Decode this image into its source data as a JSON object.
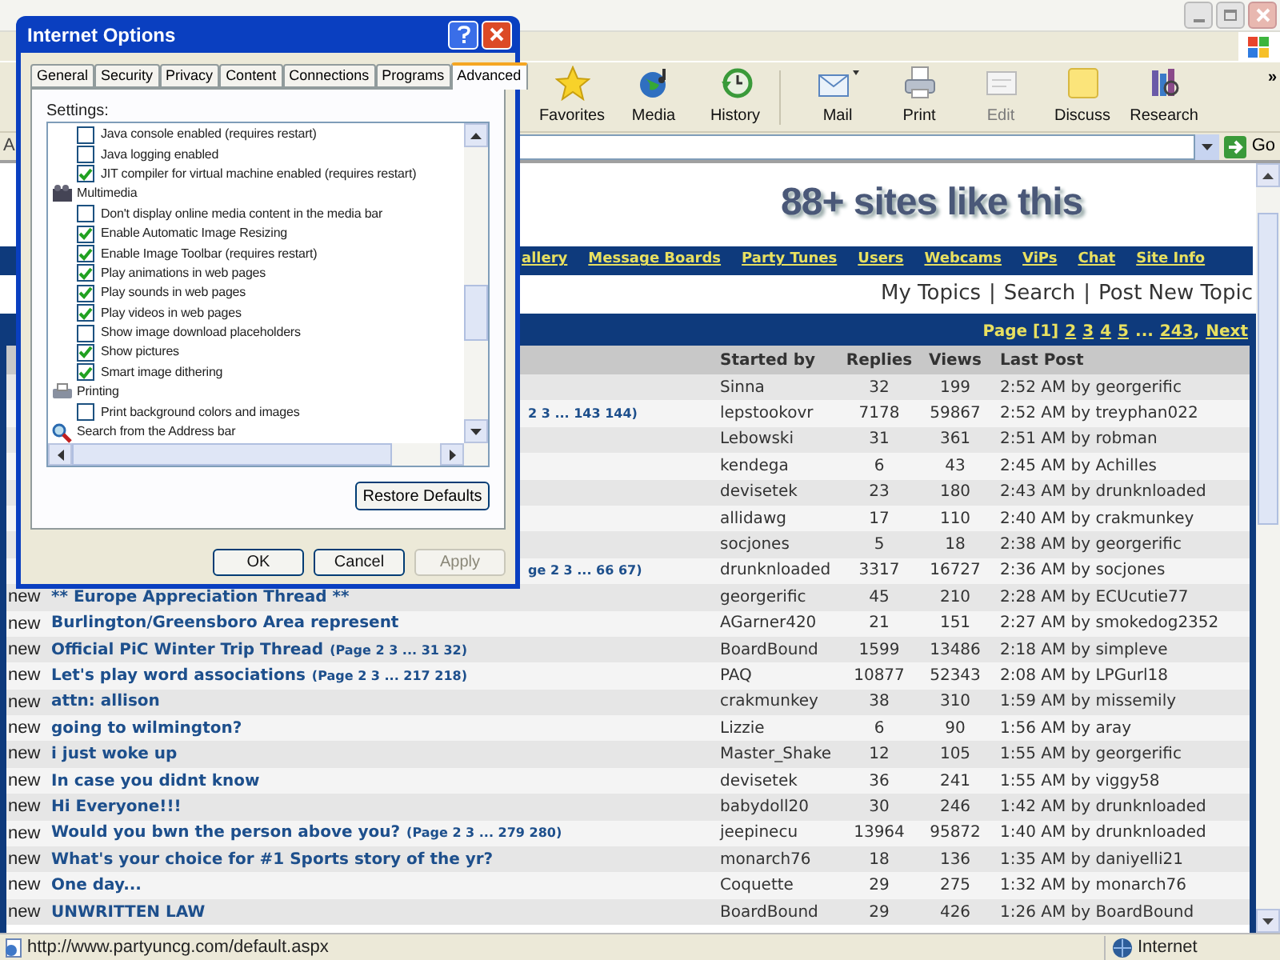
{
  "address_bar": {
    "label": "A",
    "go": "Go"
  },
  "toolbar_overflow": "»",
  "toolbar": [
    {
      "label": "Favorites",
      "disabled": false
    },
    {
      "label": "Media",
      "disabled": false
    },
    {
      "label": "History",
      "disabled": false
    },
    {
      "label": "Mail",
      "disabled": false
    },
    {
      "label": "Print",
      "disabled": false
    },
    {
      "label": "Edit",
      "disabled": true
    },
    {
      "label": "Discuss",
      "disabled": false
    },
    {
      "label": "Research",
      "disabled": false
    }
  ],
  "page": {
    "banner": "88+ sites like this",
    "nav_links": [
      "allery",
      "Message Boards",
      "Party Tunes",
      "Users",
      "Webcams",
      "ViPs",
      "Chat",
      "Site Info"
    ],
    "topic_links": {
      "items": [
        "My Topics",
        "Search",
        "Post New Topic"
      ],
      "separator": "|"
    },
    "pagination": [
      {
        "text": "Page [1]",
        "link": false
      },
      {
        "text": "2",
        "link": true
      },
      {
        "text": "3",
        "link": true
      },
      {
        "text": "4",
        "link": true
      },
      {
        "text": "5",
        "link": true
      },
      {
        "text": "...",
        "link": false
      },
      {
        "text": "243",
        "link": true,
        "suffix": ","
      },
      {
        "text": "Next",
        "link": true
      }
    ],
    "table": {
      "columns": [
        "Started by",
        "Replies",
        "Views",
        "Last Post"
      ],
      "rows": [
        {
          "started_by": "Sinna",
          "replies": "32",
          "views": "199",
          "last_post": "2:52 AM by georgerific"
        },
        {
          "pages": "2 3 ... 143 144)",
          "started_by": "lepstookovr",
          "replies": "7178",
          "views": "59867",
          "last_post": "2:52 AM by treyphan022"
        },
        {
          "started_by": "Lebowski",
          "replies": "31",
          "views": "361",
          "last_post": "2:51 AM by robman"
        },
        {
          "started_by": "kendega",
          "replies": "6",
          "views": "43",
          "last_post": "2:45 AM by Achilles"
        },
        {
          "started_by": "devisetek",
          "replies": "23",
          "views": "180",
          "last_post": "2:43 AM by drunknloaded"
        },
        {
          "started_by": "allidawg",
          "replies": "17",
          "views": "110",
          "last_post": "2:40 AM by crakmunkey"
        },
        {
          "started_by": "socjones",
          "replies": "5",
          "views": "18",
          "last_post": "2:38 AM by georgerific"
        },
        {
          "pages": "ge 2 3 ... 66 67)",
          "started_by": "drunknloaded",
          "replies": "3317",
          "views": "16727",
          "last_post": "2:36 AM by socjones"
        },
        {
          "status": "new",
          "title": "** Europe Appreciation Thread **",
          "started_by": "georgerific",
          "replies": "45",
          "views": "210",
          "last_post": "2:28 AM by ECUcutie77"
        },
        {
          "status": "new",
          "title": "Burlington/Greensboro Area represent",
          "started_by": "AGarner420",
          "replies": "21",
          "views": "151",
          "last_post": "2:27 AM by smokedog2352"
        },
        {
          "status": "new",
          "title": "Official PiC Winter Trip Thread",
          "pages": "(Page 2 3 ... 31 32)",
          "started_by": "BoardBound",
          "replies": "1599",
          "views": "13486",
          "last_post": "2:18 AM by simpleve"
        },
        {
          "status": "new",
          "title": "Let's play word associations",
          "pages": "(Page 2 3 ... 217 218)",
          "started_by": "PAQ",
          "replies": "10877",
          "views": "52343",
          "last_post": "2:08 AM by LPGurl18"
        },
        {
          "status": "new",
          "title": "attn: allison",
          "started_by": "crakmunkey",
          "replies": "38",
          "views": "310",
          "last_post": "1:59 AM by missemily"
        },
        {
          "status": "new",
          "title": "going to wilmington?",
          "started_by": "Lizzie",
          "replies": "6",
          "views": "90",
          "last_post": "1:56 AM by aray"
        },
        {
          "status": "new",
          "title": "i just woke up",
          "started_by": "Master_Shake",
          "replies": "12",
          "views": "105",
          "last_post": "1:55 AM by georgerific"
        },
        {
          "status": "new",
          "title": "In case you didnt know",
          "started_by": "devisetek",
          "replies": "36",
          "views": "241",
          "last_post": "1:55 AM by viggy58"
        },
        {
          "status": "new",
          "title": "Hi Everyone!!!",
          "started_by": "babydoll20",
          "replies": "30",
          "views": "246",
          "last_post": "1:42 AM by drunknloaded"
        },
        {
          "status": "new",
          "title": "Would you bwn the person above you?",
          "pages": "(Page 2 3 ... 279 280)",
          "started_by": "jeepinecu",
          "replies": "13964",
          "views": "95872",
          "last_post": "1:40 AM by drunknloaded"
        },
        {
          "status": "new",
          "title": "What's your choice for #1 Sports story of the yr?",
          "started_by": "monarch76",
          "replies": "18",
          "views": "136",
          "last_post": "1:35 AM by daniyelli21"
        },
        {
          "status": "new",
          "title": "One day...",
          "started_by": "Coquette",
          "replies": "29",
          "views": "275",
          "last_post": "1:32 AM by monarch76"
        },
        {
          "status": "new",
          "title": "UNWRITTEN LAW",
          "started_by": "BoardBound",
          "replies": "29",
          "views": "426",
          "last_post": "1:26 AM by BoardBound"
        }
      ]
    }
  },
  "status_bar": {
    "url": "http://www.partyuncg.com/default.aspx",
    "zone": "Internet"
  },
  "dialog": {
    "title": "Internet Options",
    "tabs": [
      {
        "label": "General",
        "selected": false
      },
      {
        "label": "Security",
        "selected": false
      },
      {
        "label": "Privacy",
        "selected": false
      },
      {
        "label": "Content",
        "selected": false
      },
      {
        "label": "Connections",
        "selected": false
      },
      {
        "label": "Programs",
        "selected": false
      },
      {
        "label": "Advanced",
        "selected": true
      }
    ],
    "settings_label": "Settings:",
    "settings": [
      {
        "kind": "checkbox",
        "label": "Java console enabled (requires restart)",
        "checked": false
      },
      {
        "kind": "checkbox",
        "label": "Java logging enabled",
        "checked": false
      },
      {
        "kind": "checkbox",
        "label": "JIT compiler for virtual machine enabled (requires restart)",
        "checked": true
      },
      {
        "kind": "category",
        "label": "Multimedia"
      },
      {
        "kind": "checkbox",
        "label": "Don't display online media content in the media bar",
        "checked": false
      },
      {
        "kind": "checkbox",
        "label": "Enable Automatic Image Resizing",
        "checked": true
      },
      {
        "kind": "checkbox",
        "label": "Enable Image Toolbar (requires restart)",
        "checked": true
      },
      {
        "kind": "checkbox",
        "label": "Play animations in web pages",
        "checked": true
      },
      {
        "kind": "checkbox",
        "label": "Play sounds in web pages",
        "checked": true
      },
      {
        "kind": "checkbox",
        "label": "Play videos in web pages",
        "checked": true
      },
      {
        "kind": "checkbox",
        "label": "Show image download placeholders",
        "checked": false
      },
      {
        "kind": "checkbox",
        "label": "Show pictures",
        "checked": true
      },
      {
        "kind": "checkbox",
        "label": "Smart image dithering",
        "checked": true
      },
      {
        "kind": "category",
        "label": "Printing"
      },
      {
        "kind": "checkbox",
        "label": "Print background colors and images",
        "checked": false
      },
      {
        "kind": "category",
        "label": "Search from the Address bar"
      }
    ],
    "restore_button": "Restore Defaults",
    "buttons": [
      {
        "label": "OK",
        "disabled": false
      },
      {
        "label": "Cancel",
        "disabled": false
      },
      {
        "label": "Apply",
        "disabled": true
      }
    ]
  }
}
